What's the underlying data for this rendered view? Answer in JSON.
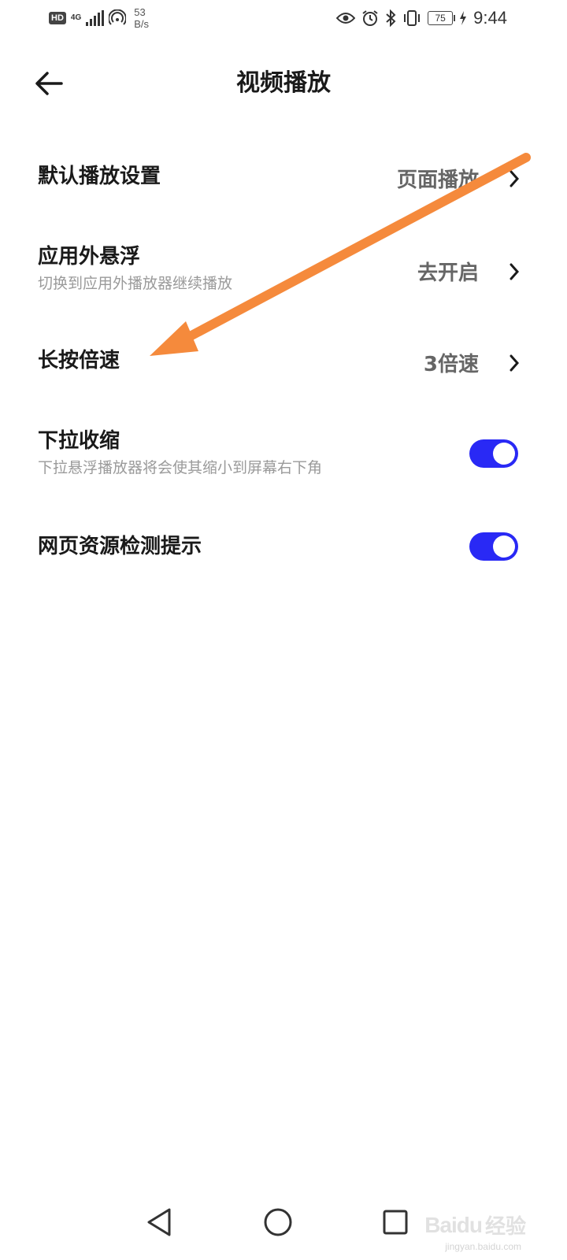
{
  "status_bar": {
    "hd": "HD",
    "network": "4G",
    "speed_value": "53",
    "speed_unit": "B/s",
    "battery": "75",
    "time": "9:44",
    "icons": [
      "eye-icon",
      "alarm-icon",
      "bluetooth-icon",
      "vibrate-icon",
      "battery-icon",
      "charging-icon"
    ]
  },
  "header": {
    "title": "视频播放",
    "back_icon": "arrow-left-icon"
  },
  "settings": {
    "default_play": {
      "title": "默认播放设置",
      "value": "页面播放"
    },
    "float_outside": {
      "title": "应用外悬浮",
      "subtitle": "切换到应用外播放器继续播放",
      "value": "去开启"
    },
    "long_press_speed": {
      "title": "长按倍速",
      "value": "3倍速"
    },
    "pull_shrink": {
      "title": "下拉收缩",
      "subtitle": "下拉悬浮播放器将会使其缩小到屏幕右下角",
      "enabled": true
    },
    "web_detect": {
      "title": "网页资源检测提示",
      "enabled": true
    }
  },
  "colors": {
    "toggle_on": "#2929f5",
    "annotation_arrow": "#f58a3c",
    "value_text": "#666666",
    "subtitle_text": "#9a9a9a"
  },
  "nav_bar": {
    "icons": [
      "back-triangle-icon",
      "home-circle-icon",
      "recents-square-icon"
    ]
  },
  "watermark": {
    "brand": "Baidu",
    "cn": "经验",
    "url": "jingyan.baidu.com"
  }
}
